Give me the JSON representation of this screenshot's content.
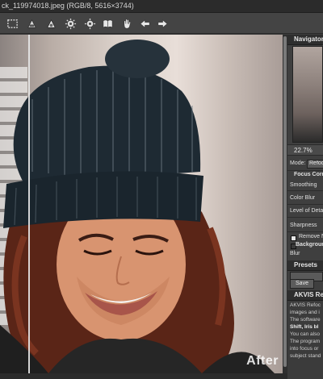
{
  "window": {
    "title": "ck_119974018.jpeg (RGB/8, 5616×3744)"
  },
  "toolbar": {
    "buttons": [
      {
        "name": "dotted-frame-icon"
      },
      {
        "name": "focus-stack-icon"
      },
      {
        "name": "run-icon"
      },
      {
        "name": "gear-icon"
      },
      {
        "name": "gear-icon"
      },
      {
        "name": "book-icon"
      },
      {
        "name": "hand-icon"
      },
      {
        "name": "arrow-left-icon"
      },
      {
        "name": "arrow-right-icon"
      }
    ]
  },
  "canvas": {
    "after_label": "After"
  },
  "panel": {
    "navigator_tab": "Navigator",
    "zoom": "22.7%",
    "mode_label": "Mode:",
    "mode_value": "Refocus",
    "section_focus": "Focus Corre",
    "smoothing": "Smoothing",
    "color_blur": "Color Blur",
    "level_of_detail": "Level of Deta",
    "sharpness": "Sharpness",
    "remove_noise": "Remove N",
    "background": "Backgroun",
    "blur": "Blur",
    "presets_tab": "Presets",
    "save_label": "Save",
    "help_title": "AKVIS Refoc",
    "help_lines": [
      "AKVIS Refoc",
      "images and i",
      "The software",
      "Shift, Iris bl",
      "You can also",
      "The program",
      "into focus or",
      "subject stand"
    ]
  },
  "colors": {
    "accent": "#3c3c3c",
    "panel_tab": "#2e2e2e"
  }
}
